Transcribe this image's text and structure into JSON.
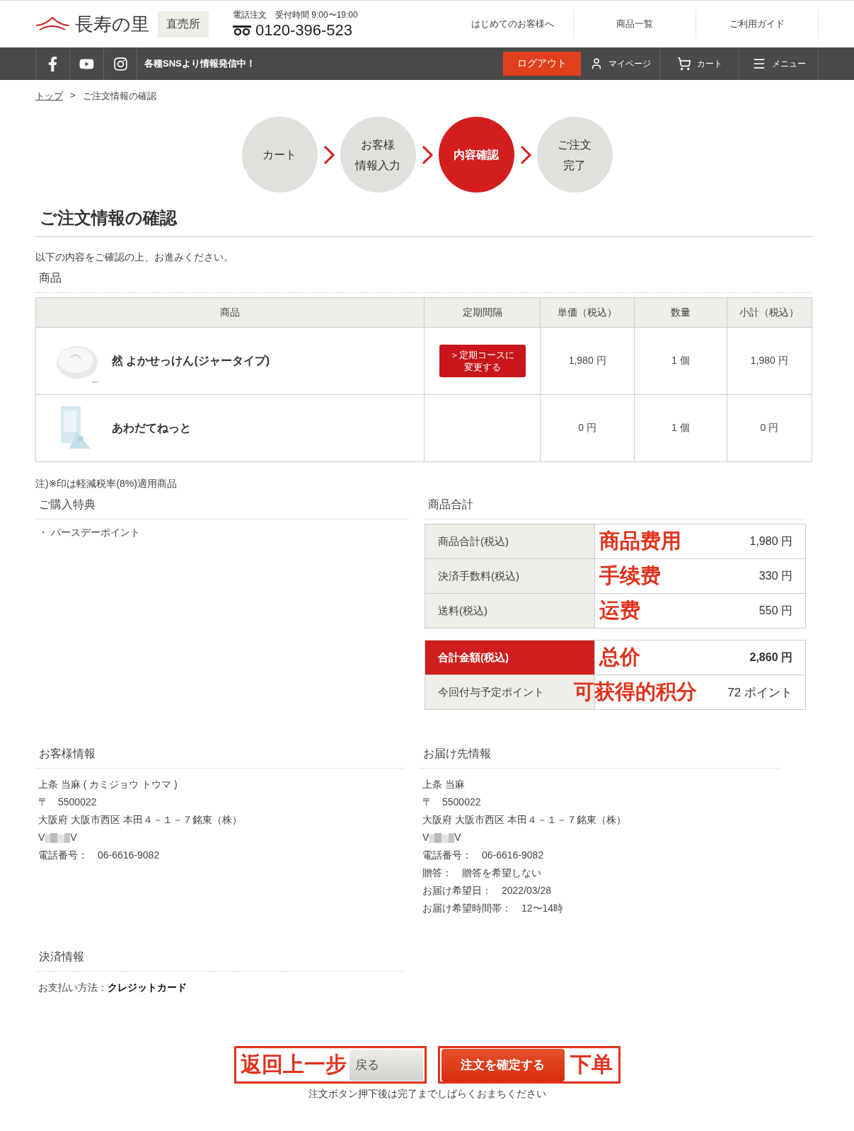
{
  "header": {
    "logo": "長寿の里",
    "store_badge": "直売所",
    "phone_hours": "電話注文　受付時間 9:00〜19:00",
    "phone": "0120-396-523",
    "links": [
      "はじめてのお客様へ",
      "商品一覧",
      "ご利用ガイド"
    ]
  },
  "navbar": {
    "sns_text": "各種SNSより情報発信中！",
    "logout": "ログアウト",
    "items": [
      {
        "kind": "user",
        "label": "マイページ"
      },
      {
        "kind": "cart",
        "label": "カート"
      },
      {
        "kind": "menu",
        "label": "メニュー"
      }
    ]
  },
  "breadcrumb": {
    "items": [
      {
        "label": "トップ",
        "kind": "link"
      },
      {
        "label": "ご注文情報の確認",
        "kind": "current"
      }
    ],
    "separator": ">"
  },
  "steps": [
    {
      "lines": [
        "カート"
      ],
      "selected": false
    },
    {
      "lines": [
        "お客様",
        "情報入力"
      ],
      "selected": false
    },
    {
      "lines": [
        "内容確認"
      ],
      "selected": true
    },
    {
      "lines": [
        "ご注文",
        "完了"
      ],
      "selected": false
    }
  ],
  "page_title": "ご注文情報の確認",
  "intro": "以下の内容をご確認の上、お進みください。",
  "products_heading": "商品",
  "table": {
    "columns": [
      "商品",
      "定期間隔",
      "単価（税込）",
      "数量",
      "小計（税込）"
    ],
    "rows": [
      {
        "name": "然 よかせっけん(ジャータイプ)",
        "subscription_button": [
          "＞定期コースに",
          "変更する"
        ],
        "unit_price": "1,980 円",
        "quantity": "1 個",
        "subtotal": "1,980 円"
      },
      {
        "name": "あわだてねっと",
        "unit_price": "0 円",
        "quantity": "1 個",
        "subtotal": "0 円"
      }
    ]
  },
  "note": "注)※印は軽減税率(8%)適用商品",
  "benefits": {
    "heading": "ご購入特典",
    "items": [
      "・ バースデーポイント"
    ]
  },
  "totals": {
    "heading": "商品合計",
    "groups": [
      [
        {
          "kind": "normal",
          "label": "商品合計(税込)",
          "annotation": "商品费用",
          "value": "1,980 円"
        },
        {
          "kind": "normal",
          "label": "決済手数料(税込)",
          "annotation": "手续费",
          "value": "330 円"
        },
        {
          "kind": "normal",
          "label": "送料(税込)",
          "annotation": "运费",
          "value": "550 円"
        }
      ],
      [
        {
          "kind": "total",
          "label": "合計金額(税込)",
          "annotation": "总价",
          "value": "2,860 円"
        },
        {
          "kind": "points",
          "label": "今回付与予定ポイント",
          "annotation": "可获得的积分",
          "value": "72 ポイント"
        }
      ]
    ]
  },
  "customer": {
    "heading": "お客様情報",
    "lines": [
      {
        "kind": "text",
        "text": "上条 当麻 ( カミジョウ トウマ )"
      },
      {
        "kind": "text",
        "text": "〒　5500022"
      },
      {
        "kind": "text",
        "text": "大阪府 大阪市西区 本田４－１－７銘東（株）"
      },
      {
        "kind": "redacted",
        "before": "V",
        "after": "V"
      },
      {
        "kind": "text",
        "text": "電話番号：　06-6616-9082"
      }
    ]
  },
  "delivery": {
    "heading": "お届け先情報",
    "lines": [
      {
        "kind": "text",
        "text": "上条 当麻"
      },
      {
        "kind": "text",
        "text": "〒　5500022"
      },
      {
        "kind": "text",
        "text": "大阪府 大阪市西区 本田４－１－７銘東（株）"
      },
      {
        "kind": "redacted",
        "before": "V",
        "after": "V"
      },
      {
        "kind": "text",
        "text": "電話番号：　06-6616-9082"
      },
      {
        "kind": "text",
        "text": "贈答：　贈答を希望しない"
      },
      {
        "kind": "text",
        "text": "お届け希望日：　2022/03/28"
      },
      {
        "kind": "text",
        "text": "お届け希望時間帯：　12〜14時"
      }
    ]
  },
  "payment": {
    "heading": "決済情報",
    "label": "お支払い方法：",
    "value": "クレジットカード"
  },
  "actions": {
    "back": {
      "annotation": "返回上一步",
      "label": "戻る"
    },
    "confirm": {
      "label": "注文を確定する",
      "annotation": "下单"
    },
    "caption": "注文ボタン押下後は完了までしばらくおまちください"
  }
}
